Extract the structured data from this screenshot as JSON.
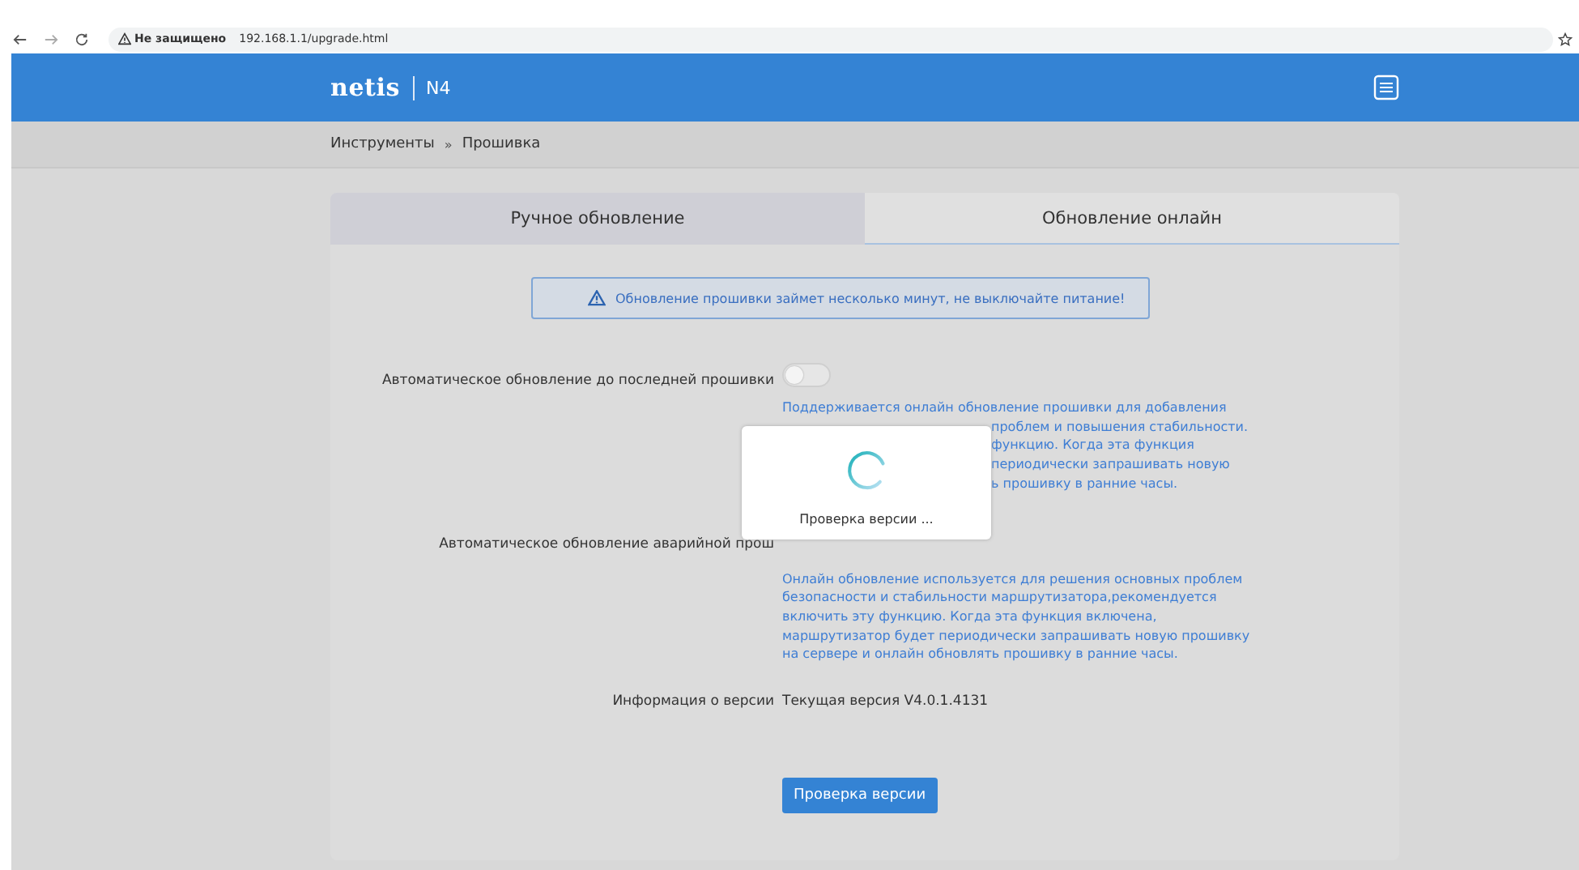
{
  "browser": {
    "security": "Не защищено",
    "url": "192.168.1.1/upgrade.html"
  },
  "header": {
    "logo": "netis",
    "model": "N4"
  },
  "breadcrumb": [
    "Инструменты",
    "»",
    "Прошивка"
  ],
  "tabs": [
    {
      "label": "Ручное обновление",
      "selected": false
    },
    {
      "label": "Обновление онлайн",
      "selected": true
    }
  ],
  "notice": "Обновление прошивки займет несколько минут, не выключайте питание!",
  "rows": [
    {
      "kind": "toggle",
      "label": "Автоматическое обновление до последней прошивки",
      "on": false
    },
    {
      "kind": "description",
      "lines": [
        {
          "text": "Поддерживается онлайн обновление прошивки для добавления",
          "covered": false
        },
        {
          "text": "проблем и повышения стабильности.",
          "covered": true
        },
        {
          "text": "функцию. Когда эта функция",
          "covered": true
        },
        {
          "text": "периодически запрашивать новую",
          "covered": true
        },
        {
          "text": "ь прошивку в ранние часы.",
          "covered": true
        }
      ]
    },
    {
      "kind": "label",
      "label": "Автоматическое обновление аварийной прош"
    },
    {
      "kind": "description",
      "lines": [
        {
          "text": "Онлайн обновление используется для решения основных проблем",
          "covered": false
        },
        {
          "text": "безопасности и стабильности маршрутизатора,рекомендуется",
          "covered": false
        },
        {
          "text": "включить эту функцию. Когда эта функция включена,",
          "covered": false
        },
        {
          "text": "маршрутизатор будет периодически запрашивать новую прошивку",
          "covered": false
        },
        {
          "text": "на сервере и онлайн обновлять прошивку в ранние часы.",
          "covered": false
        }
      ]
    },
    {
      "kind": "info",
      "label": "Информация о версии",
      "value": "Текущая версия V4.0.1.4131"
    },
    {
      "kind": "button",
      "label": "Проверка версии"
    }
  ],
  "modal": {
    "text": "Проверка версии ..."
  }
}
